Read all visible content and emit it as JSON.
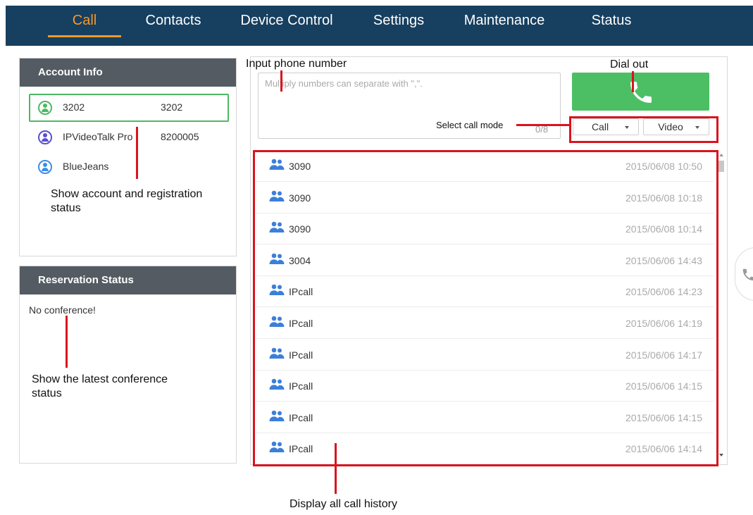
{
  "nav": {
    "tabs": [
      {
        "label": "Call",
        "active": true
      },
      {
        "label": "Contacts",
        "active": false
      },
      {
        "label": "Device Control",
        "active": false
      },
      {
        "label": "Settings",
        "active": false
      },
      {
        "label": "Maintenance",
        "active": false
      },
      {
        "label": "Status",
        "active": false
      }
    ]
  },
  "account_info": {
    "title": "Account Info",
    "accounts": [
      {
        "name": "3202",
        "number": "3202",
        "icon": "user-icon-green",
        "color": "#4cb963",
        "selected": true
      },
      {
        "name": "IPVideoTalk Pro",
        "number": "8200005",
        "icon": "user-icon-purple",
        "color": "#5a4fcf",
        "selected": false
      },
      {
        "name": "BlueJeans",
        "number": "",
        "icon": "user-icon-blue",
        "color": "#3c8ee6",
        "selected": false
      }
    ]
  },
  "reservation": {
    "title": "Reservation Status",
    "status_text": "No conference!"
  },
  "dial": {
    "placeholder": "Multiply numbers can separate with \",\".",
    "counter": "0/8",
    "call_mode": "Call",
    "video_mode": "Video"
  },
  "history": [
    {
      "name": "3090",
      "time": "2015/06/08 10:50"
    },
    {
      "name": "3090",
      "time": "2015/06/08 10:18"
    },
    {
      "name": "3090",
      "time": "2015/06/08 10:14"
    },
    {
      "name": "3004",
      "time": "2015/06/06 14:43"
    },
    {
      "name": "IPcall",
      "time": "2015/06/06 14:23"
    },
    {
      "name": "IPcall",
      "time": "2015/06/06 14:19"
    },
    {
      "name": "IPcall",
      "time": "2015/06/06 14:17"
    },
    {
      "name": "IPcall",
      "time": "2015/06/06 14:15"
    },
    {
      "name": "IPcall",
      "time": "2015/06/06 14:15"
    },
    {
      "name": "IPcall",
      "time": "2015/06/06 14:14"
    }
  ],
  "annotations": {
    "input_phone": "Input phone number",
    "dial_out": "Dial out",
    "select_mode": "Select call mode",
    "account_status": "Show account and registration status",
    "conference_status": "Show the latest conference status",
    "call_history": "Display all call history"
  },
  "colors": {
    "nav_bg": "#173f5f",
    "accent": "#f39a2a",
    "dial_green": "#4cbf65",
    "annotation_red": "#d9141e"
  }
}
